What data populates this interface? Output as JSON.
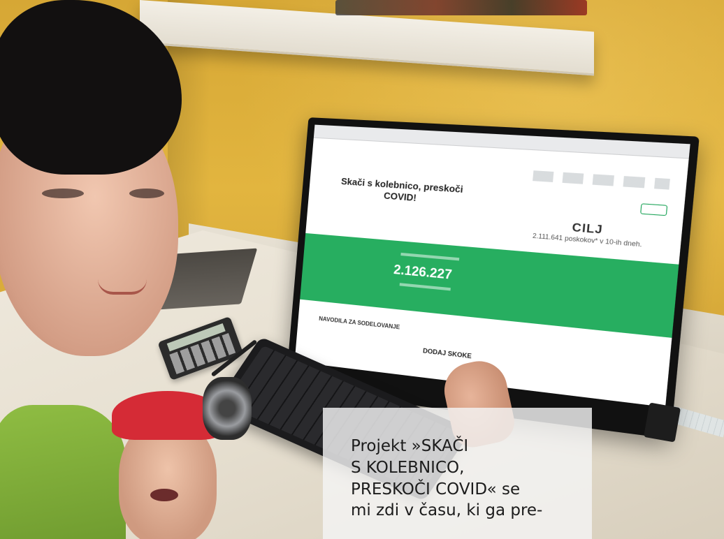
{
  "caption": {
    "lines": [
      "Projekt »SKAČI",
      "S KOLEBNICO,",
      "PRESKOČI COVID« se",
      "mi zdi v času, ki ga pre-"
    ]
  },
  "screen": {
    "title": "Skači s kolebnico, preskoči COVID!",
    "goal_label": "CILJ",
    "goal_text": "2.111.641 poskokov* v 10-ih dneh.",
    "counter": "2.126.227",
    "link_instructions": "NAVODILA ZA SODELOVANJE",
    "button_add": "DODAJ SKOKE"
  },
  "colors": {
    "wall": "#e2b53f",
    "banner_green": "#27ae60",
    "headband_red": "#d52b36",
    "shirt_green": "#8fbd43"
  }
}
